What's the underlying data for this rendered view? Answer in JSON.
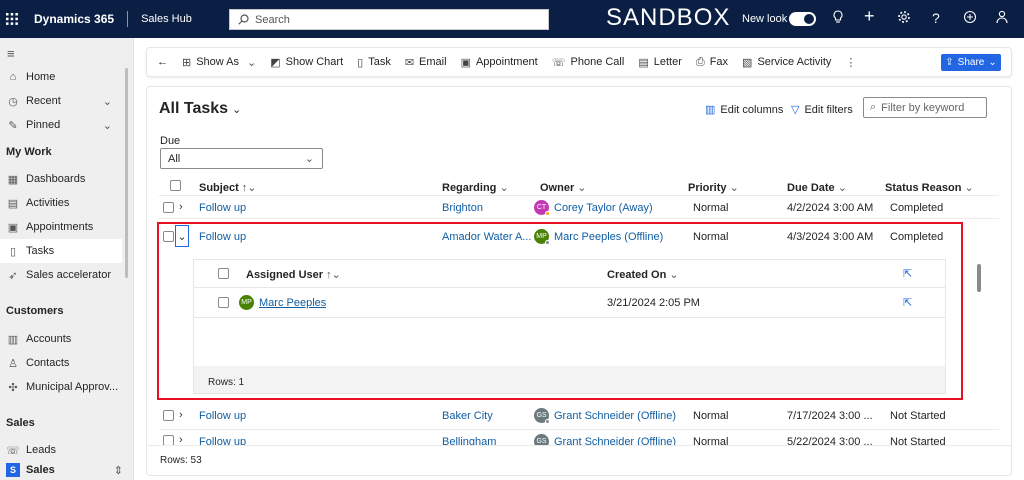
{
  "topbar": {
    "app_name": "Dynamics 365",
    "area_name": "Sales Hub",
    "search_placeholder": "Search",
    "env_label": "SANDBOX",
    "new_look_label": "New look",
    "colors": {
      "bar": "#0b1f44"
    }
  },
  "sidebar": {
    "items_top": [
      {
        "label": "Home",
        "icon": "home-icon"
      },
      {
        "label": "Recent",
        "icon": "clock-icon"
      },
      {
        "label": "Pinned",
        "icon": "pin-icon"
      }
    ],
    "section_mywork": "My Work",
    "mywork": [
      {
        "label": "Dashboards",
        "icon": "dashboard-icon"
      },
      {
        "label": "Activities",
        "icon": "activities-icon"
      },
      {
        "label": "Appointments",
        "icon": "calendar-icon"
      },
      {
        "label": "Tasks",
        "icon": "task-icon"
      },
      {
        "label": "Sales accelerator",
        "icon": "rocket-icon"
      }
    ],
    "section_customers": "Customers",
    "customers": [
      {
        "label": "Accounts",
        "icon": "building-icon"
      },
      {
        "label": "Contacts",
        "icon": "person-icon"
      },
      {
        "label": "Municipal Approv...",
        "icon": "puzzle-icon"
      }
    ],
    "section_sales": "Sales",
    "sales": [
      {
        "label": "Leads",
        "icon": "phone-icon"
      }
    ],
    "area_badge": "S",
    "area_label": "Sales"
  },
  "commandbar": {
    "show_as": "Show As",
    "show_chart": "Show Chart",
    "task": "Task",
    "email": "Email",
    "appointment": "Appointment",
    "phone_call": "Phone Call",
    "letter": "Letter",
    "fax": "Fax",
    "service_activity": "Service Activity",
    "share": "Share"
  },
  "view": {
    "title": "All Tasks",
    "edit_columns": "Edit columns",
    "edit_filters": "Edit filters",
    "filter_placeholder": "Filter by keyword",
    "due_label": "Due",
    "due_value": "All",
    "columns": [
      "Subject",
      "Regarding",
      "Owner",
      "Priority",
      "Due Date",
      "Status Reason"
    ],
    "rows": [
      {
        "subject": "Follow up",
        "regarding": "Brighton",
        "owner": "Corey Taylor (Away)",
        "initials": "CT",
        "avatar_color": "#c239b3",
        "presence": "#f8a51c",
        "priority": "Normal",
        "due": "4/2/2024 3:00 AM",
        "status": "Completed"
      },
      {
        "subject": "Follow up",
        "regarding": "Amador Water A...",
        "owner": "Marc Peeples (Offline)",
        "initials": "MP",
        "avatar_color": "#498205",
        "presence": "#8a8a8a",
        "priority": "Normal",
        "due": "4/3/2024 3:00 AM",
        "status": "Completed"
      },
      {
        "subject": "Follow up",
        "regarding": "Baker City",
        "owner": "Grant Schneider (Offline)",
        "initials": "GS",
        "avatar_color": "#69797e",
        "presence": "#8a8a8a",
        "priority": "Normal",
        "due": "7/17/2024 3:00 ...",
        "status": "Not Started"
      },
      {
        "subject": "Follow up",
        "regarding": "Bellingham",
        "owner": "Grant Schneider (Offline)",
        "initials": "GS",
        "avatar_color": "#69797e",
        "presence": "#8a8a8a",
        "priority": "Normal",
        "due": "5/22/2024 3:00 ...",
        "status": "Not Started"
      }
    ],
    "subgrid": {
      "col_user": "Assigned User",
      "col_created": "Created On",
      "row_user": "Marc Peeples",
      "row_initials": "MP",
      "row_created": "3/21/2024 2:05 PM",
      "rows_label": "Rows: 1"
    },
    "rows_label": "Rows: 53"
  }
}
